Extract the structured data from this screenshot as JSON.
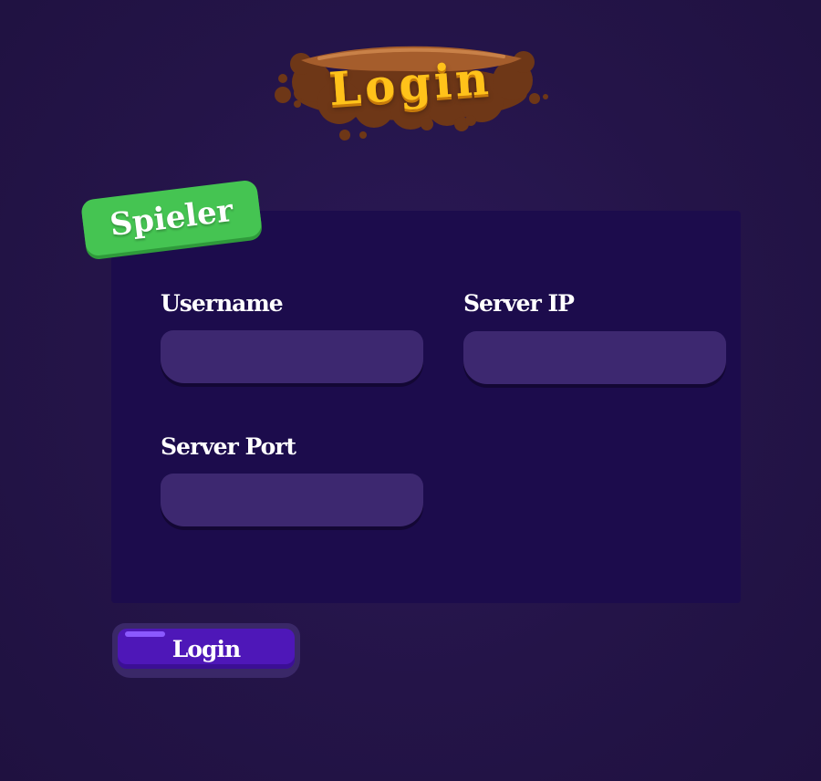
{
  "title": {
    "text": "Login",
    "text_color": "#ffc21a",
    "splat_color": "#7a3f1c"
  },
  "tab": {
    "label": "Spieler",
    "color": "#45c452"
  },
  "form": {
    "username": {
      "label": "Username",
      "value": "",
      "placeholder": ""
    },
    "server_ip": {
      "label": "Server IP",
      "value": "",
      "placeholder": ""
    },
    "server_port": {
      "label": "Server Port",
      "value": "",
      "placeholder": ""
    }
  },
  "login_button": {
    "label": "Login",
    "color": "#4e17b8"
  },
  "colors": {
    "background": "#241448",
    "panel": "#1c0c4c",
    "input": "#3d2870"
  }
}
